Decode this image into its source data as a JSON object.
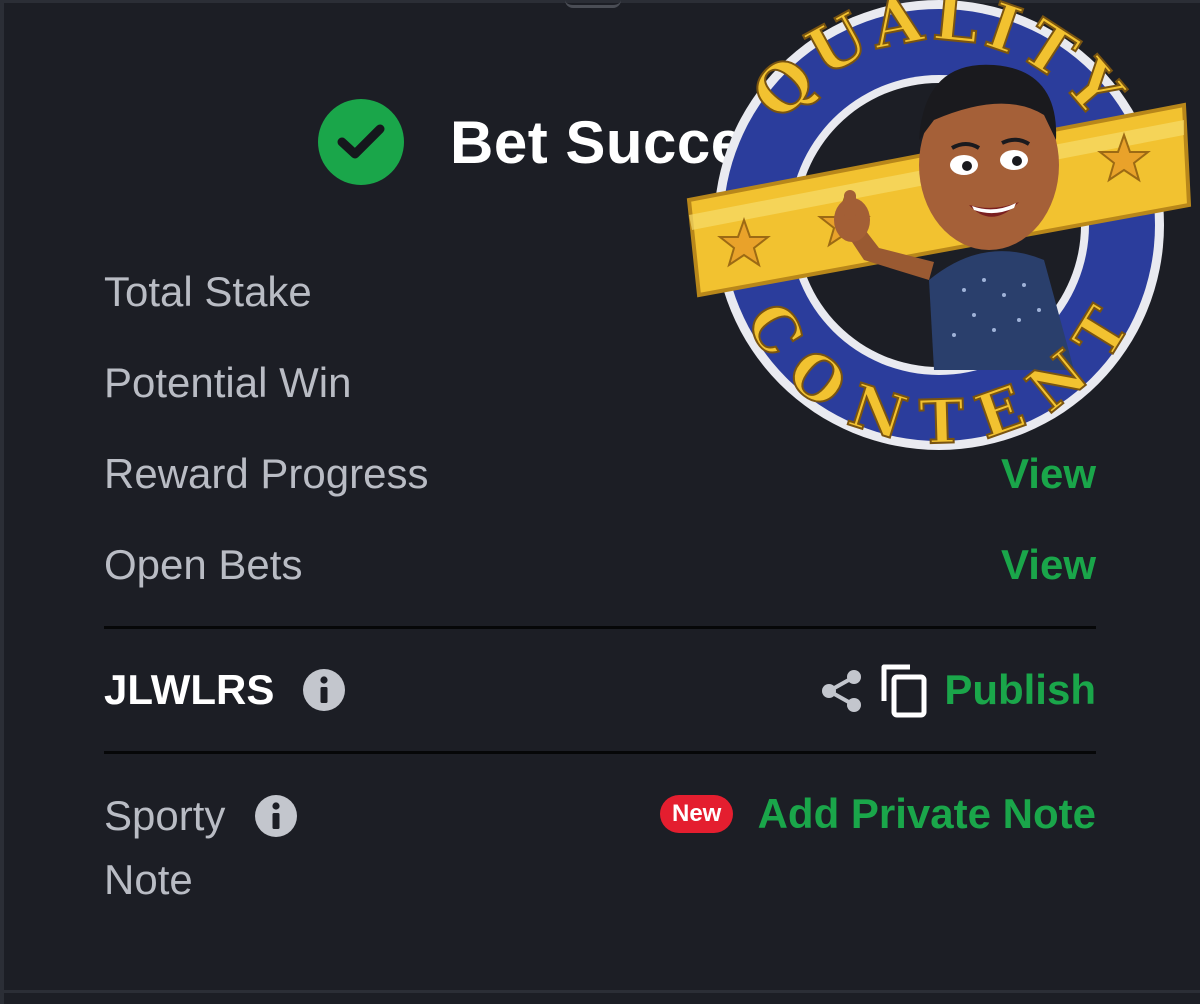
{
  "header": {
    "title": "Bet Successful"
  },
  "rows": [
    {
      "label": "Total Stake",
      "value": ""
    },
    {
      "label": "Potential Win",
      "value": ""
    },
    {
      "label": "Reward Progress",
      "value": "View"
    },
    {
      "label": "Open Bets",
      "value": "View"
    }
  ],
  "booking": {
    "code": "JLWLRS",
    "publish_label": "Publish"
  },
  "note": {
    "label": "Sporty Note",
    "badge": "New",
    "action": "Add Private Note"
  },
  "sticker": {
    "text_top": "QUALITY",
    "text_bottom": "CONTENT"
  },
  "colors": {
    "accent": "#1aa64a",
    "badge": "#e41e2f",
    "background": "#1c1e25",
    "sticker_blue": "#2b3d9c",
    "sticker_gold": "#f2c230"
  },
  "icons": {
    "success": "check-circle-icon",
    "info": "info-icon",
    "share": "share-icon",
    "copy": "copy-icon"
  }
}
